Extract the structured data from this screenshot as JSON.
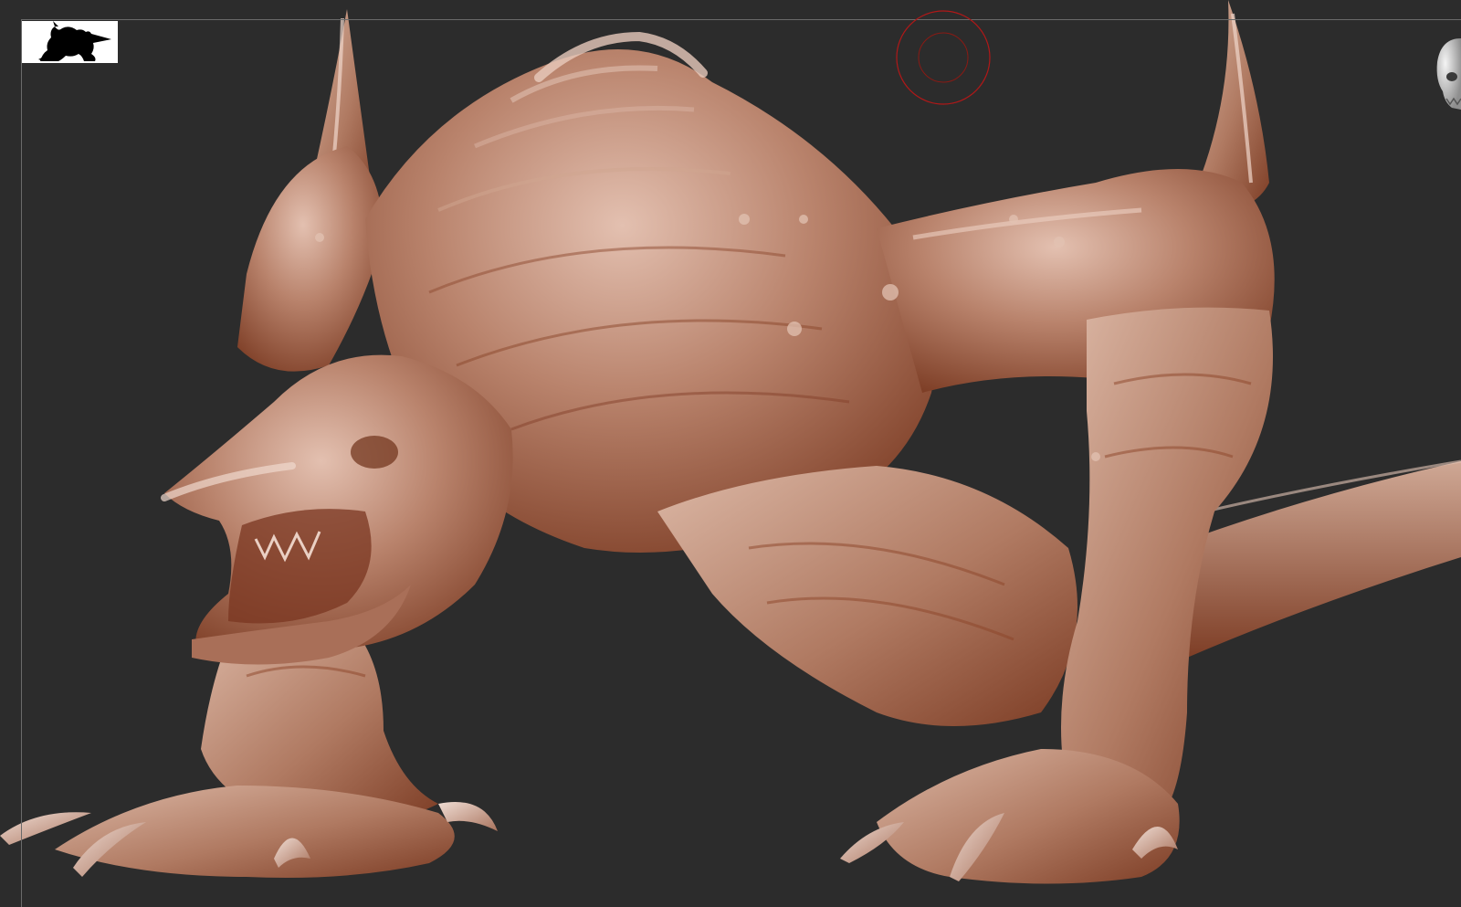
{
  "viewport": {
    "background": "#2c2c2c",
    "frame_color": "#6a6a6a"
  },
  "thumbnail": {
    "icon": "creature-silhouette-icon",
    "background": "#ffffff",
    "silhouette_color": "#000000"
  },
  "brush_cursor": {
    "icon": "brush-radius-circle-icon",
    "color": "#b01818"
  },
  "mesh": {
    "subject": "sculpted-creature-mesh",
    "material_base": "#b8826c",
    "material_shadow": "#7a3820",
    "material_highlight": "#e6c4b4"
  },
  "navigation_gizmo": {
    "icon": "skull-orientation-icon"
  }
}
